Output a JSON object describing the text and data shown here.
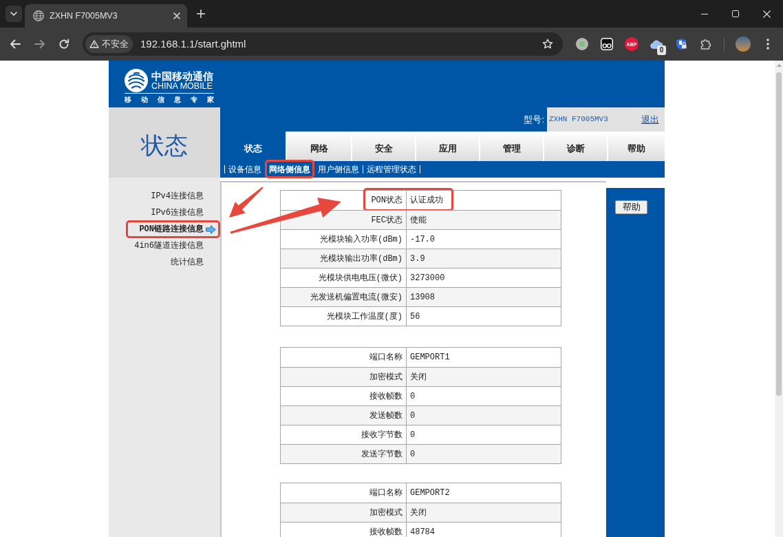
{
  "browser": {
    "tab_title": "ZXHN F7005MV3",
    "security_label": "不安全",
    "url": "192.168.1.1/start.ghtml",
    "extensions": [
      {
        "kind": "dot"
      },
      {
        "kind": "eyes"
      },
      {
        "kind": "label",
        "label": "ABP"
      },
      {
        "kind": "cloud",
        "count": "0"
      },
      {
        "kind": "shield"
      },
      {
        "kind": "puzzle"
      }
    ]
  },
  "logo": {
    "name": "中国移动通信",
    "name_en": "CHINA MOBILE",
    "slogan": "移 动 信 息 专 家"
  },
  "section_title": "状态",
  "model": {
    "label": "型号:",
    "value": "ZXHN F7005MV3"
  },
  "logout": "退出",
  "tabs": [
    {
      "label": "状态",
      "selected": true
    },
    {
      "label": "网络",
      "selected": false
    },
    {
      "label": "安全",
      "selected": false
    },
    {
      "label": "应用",
      "selected": false
    },
    {
      "label": "管理",
      "selected": false
    },
    {
      "label": "诊断",
      "selected": false
    },
    {
      "label": "帮助",
      "selected": false
    }
  ],
  "subnav": [
    {
      "label": "设备信息",
      "selected": false,
      "highlighted": false
    },
    {
      "label": "网络侧信息",
      "selected": true,
      "highlighted": true
    },
    {
      "label": "用户侧信息",
      "selected": false,
      "highlighted": false
    },
    {
      "label": "远程管理状态",
      "selected": false,
      "highlighted": false
    }
  ],
  "sidebar": {
    "items": [
      {
        "label": "IPv4连接信息",
        "selected": false,
        "highlighted": false
      },
      {
        "label": "IPv6连接信息",
        "selected": false,
        "highlighted": false
      },
      {
        "label": "PON链路连接信息",
        "selected": true,
        "highlighted": true
      },
      {
        "label": "4in6隧道连接信息",
        "selected": false,
        "highlighted": false
      },
      {
        "label": "统计信息",
        "selected": false,
        "highlighted": false
      }
    ]
  },
  "tables": [
    {
      "rows": [
        {
          "label": "PON状态",
          "value": "认证成功",
          "highlighted": true
        },
        {
          "label": "FEC状态",
          "value": "使能",
          "highlighted": false
        },
        {
          "label": "光模块输入功率(dBm)",
          "value": "-17.0",
          "highlighted": false
        },
        {
          "label": "光模块输出功率(dBm)",
          "value": "3.9",
          "highlighted": false
        },
        {
          "label": "光模块供电电压(微伏)",
          "value": "3273000",
          "highlighted": false
        },
        {
          "label": "光发送机偏置电流(微安)",
          "value": "13908",
          "highlighted": false
        },
        {
          "label": "光模块工作温度(度)",
          "value": "56",
          "highlighted": false
        }
      ]
    },
    {
      "rows": [
        {
          "label": "端口名称",
          "value": "GEMPORT1",
          "highlighted": false
        },
        {
          "label": "加密模式",
          "value": "关闭",
          "highlighted": false
        },
        {
          "label": "接收帧数",
          "value": "0",
          "highlighted": false
        },
        {
          "label": "发送帧数",
          "value": "0",
          "highlighted": false
        },
        {
          "label": "接收字节数",
          "value": "0",
          "highlighted": false
        },
        {
          "label": "发送字节数",
          "value": "0",
          "highlighted": false
        }
      ]
    },
    {
      "rows": [
        {
          "label": "端口名称",
          "value": "GEMPORT2",
          "highlighted": false
        },
        {
          "label": "加密模式",
          "value": "关闭",
          "highlighted": false
        },
        {
          "label": "接收帧数",
          "value": "48784",
          "highlighted": false
        }
      ]
    }
  ],
  "help_button": "帮助"
}
